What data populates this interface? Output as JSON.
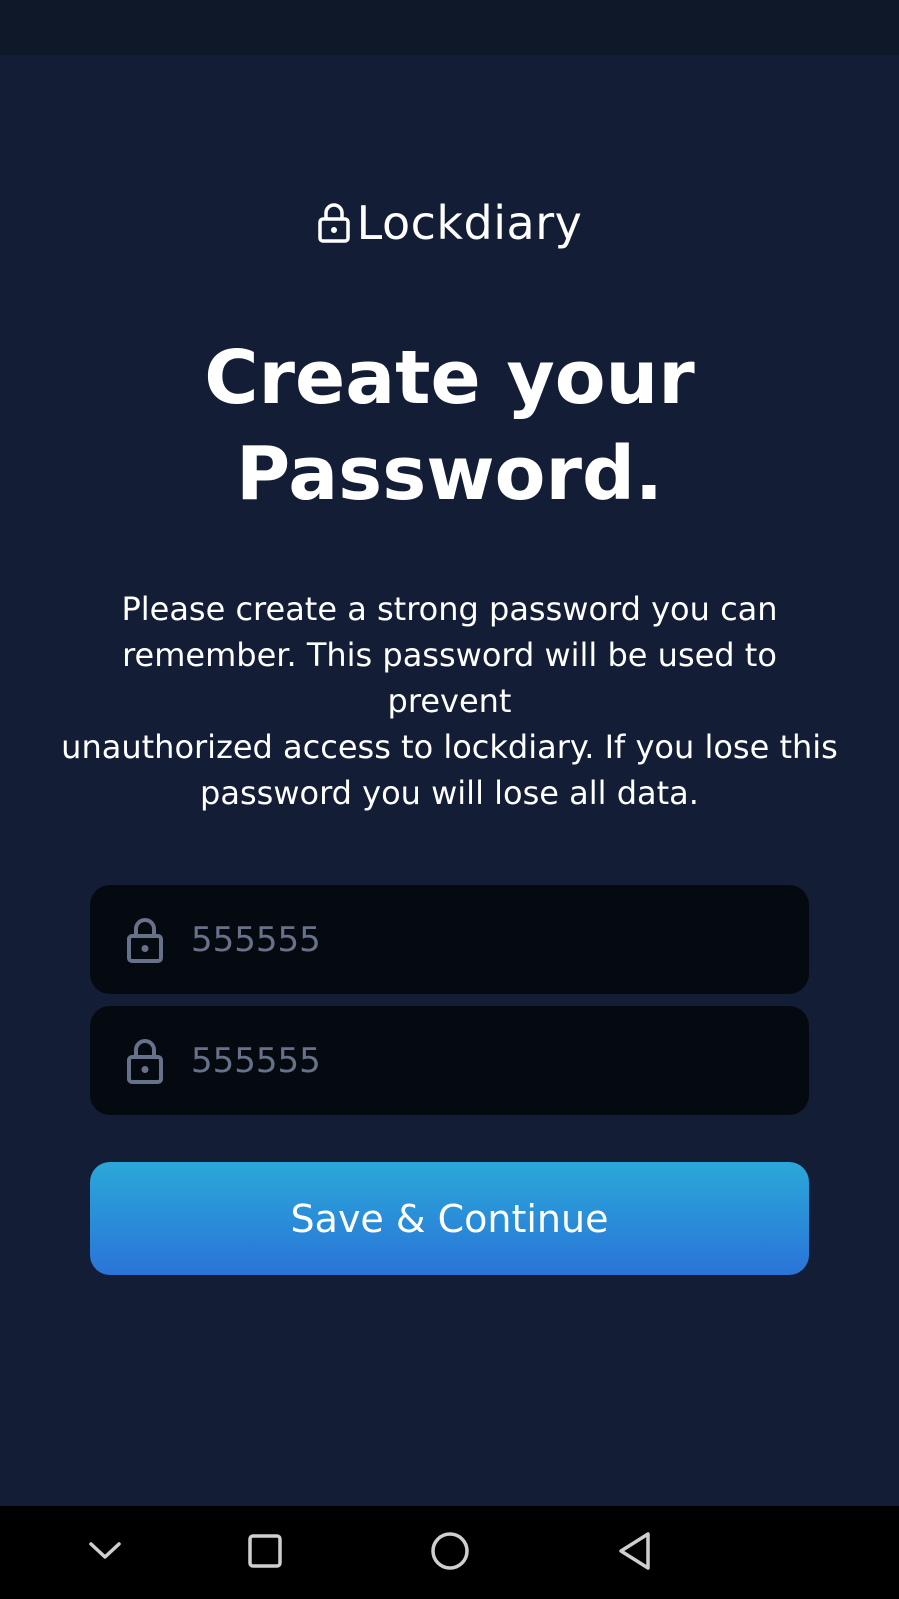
{
  "app": {
    "name": "Lockdiary",
    "logo_icon": "lock-icon"
  },
  "page": {
    "title_line1": "Create your",
    "title_line2": "Password.",
    "description_lines": [
      "Please create a strong password you can",
      "remember. This password will be used to",
      "prevent",
      "unauthorized access to lockdiary. If you lose this",
      "password you will lose all data."
    ]
  },
  "form": {
    "password": {
      "value": "555555",
      "icon": "lock-icon"
    },
    "confirm_password": {
      "value": "555555",
      "icon": "lock-icon"
    },
    "save_label": "Save & Continue"
  },
  "navbar": {
    "icons": [
      "chevron-down-icon",
      "recent-apps-icon",
      "home-icon",
      "back-icon"
    ]
  },
  "colors": {
    "background": "#131e36",
    "status_bar": "#0f1829",
    "field_background": "#050910",
    "field_text": "#67718a",
    "button_gradient_top": "#2aa8d8",
    "button_gradient_bottom": "#2a74d8",
    "nav_bar": "#000000"
  }
}
